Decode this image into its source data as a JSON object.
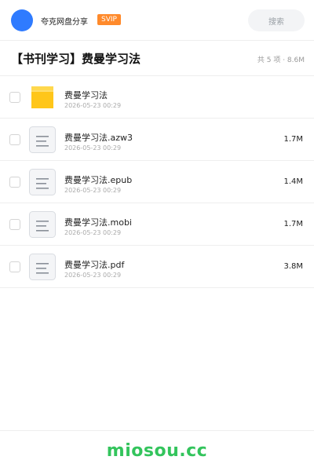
{
  "header": {
    "app_name": "夸克网盘分享",
    "badge": "SVIP",
    "search_placeholder": "搜索",
    "avatar_color": "#2f7bff",
    "badge_color": "#ff8a2b"
  },
  "folder": {
    "title": "【书刊学习】费曼学习法",
    "summary": "共 5 项 · 8.6M"
  },
  "files": [
    {
      "name": "费曼学习法",
      "date": "2026-05-23 00:29",
      "size": "",
      "type": "folder-icon"
    },
    {
      "name": "费曼学习法.azw3",
      "date": "2026-05-23 00:29",
      "size": "1.7M",
      "type": "document-icon"
    },
    {
      "name": "费曼学习法.epub",
      "date": "2026-05-23 00:29",
      "size": "1.4M",
      "type": "document-icon"
    },
    {
      "name": "费曼学习法.mobi",
      "date": "2026-05-23 00:29",
      "size": "1.7M",
      "type": "document-icon"
    },
    {
      "name": "费曼学习法.pdf",
      "date": "2026-05-23 00:29",
      "size": "3.8M",
      "type": "document-icon"
    }
  ],
  "footer": {
    "brand": "miosou.cc",
    "brand_color": "#33c45c"
  }
}
